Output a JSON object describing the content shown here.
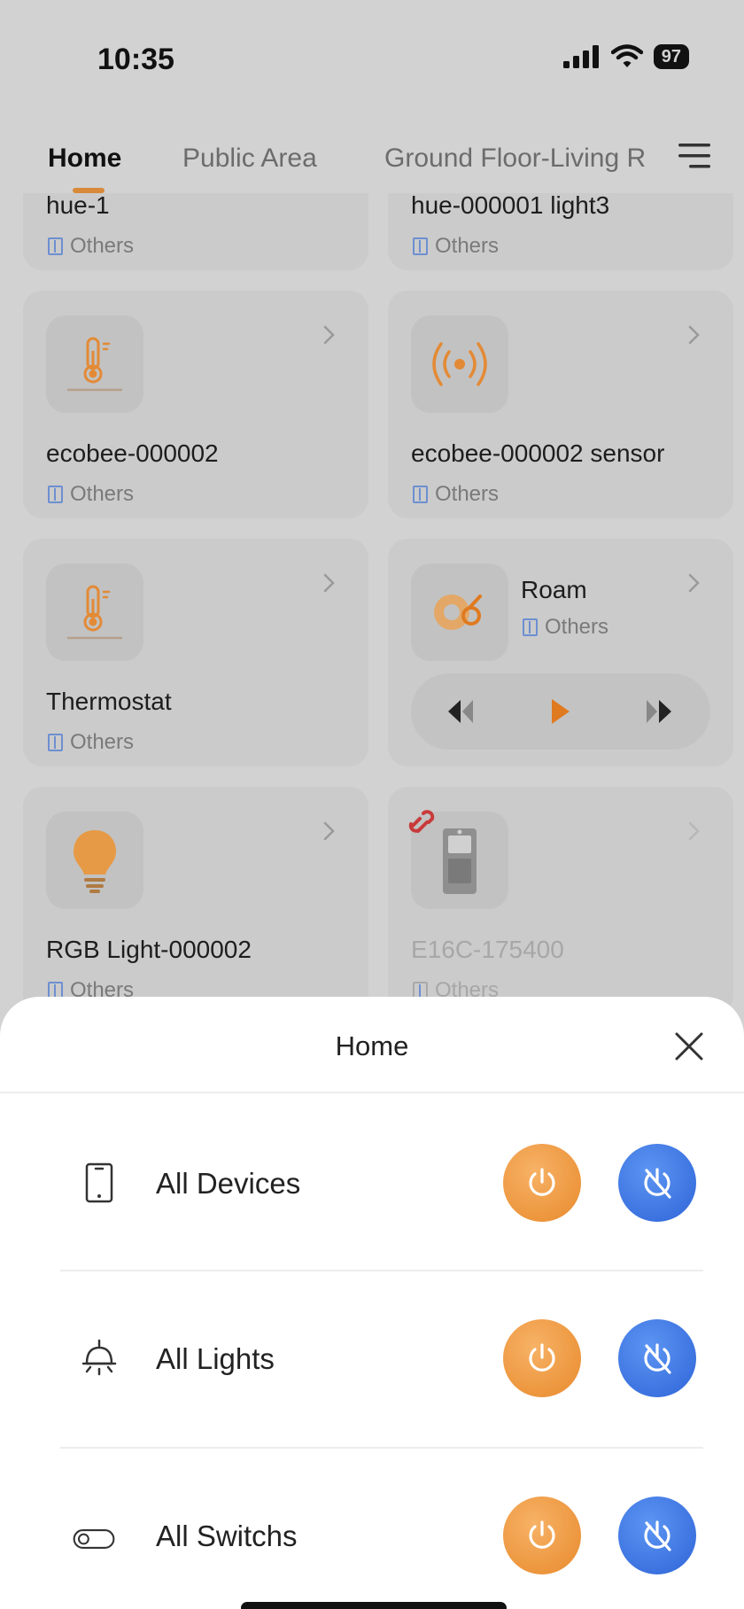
{
  "status": {
    "time": "10:35",
    "battery": "97"
  },
  "tabs": [
    {
      "label": "Home",
      "active": true
    },
    {
      "label": "Public Area",
      "active": false
    },
    {
      "label": "Ground Floor-Living R",
      "active": false
    }
  ],
  "devices": [
    {
      "name": "hue-1",
      "room": "Others"
    },
    {
      "name": "hue-000001 light3",
      "room": "Others"
    },
    {
      "name": "ecobee-000002",
      "room": "Others",
      "icon": "thermometer-icon"
    },
    {
      "name": "ecobee-000002 sensor",
      "room": "Others",
      "icon": "sensor-signal-icon"
    },
    {
      "name": "Thermostat",
      "room": "Others",
      "icon": "thermometer-icon"
    },
    {
      "name": "Roam",
      "room": "Others",
      "icon": "speaker-icon"
    },
    {
      "name": "RGB Light-000002",
      "room": "Others",
      "icon": "light-bulb-icon"
    },
    {
      "name": "E16C-175400",
      "room": "Others",
      "icon": "door-panel-icon",
      "offline": true
    }
  ],
  "sheet": {
    "title": "Home",
    "rows": [
      {
        "label": "All Devices",
        "icon": "phone-icon"
      },
      {
        "label": "All Lights",
        "icon": "lamp-icon"
      },
      {
        "label": "All Switchs",
        "icon": "toggle-icon"
      }
    ]
  },
  "colors": {
    "accent": "#e88a2c",
    "off_blue": "#2e64d8",
    "room_icon": "#6d8fd1"
  }
}
